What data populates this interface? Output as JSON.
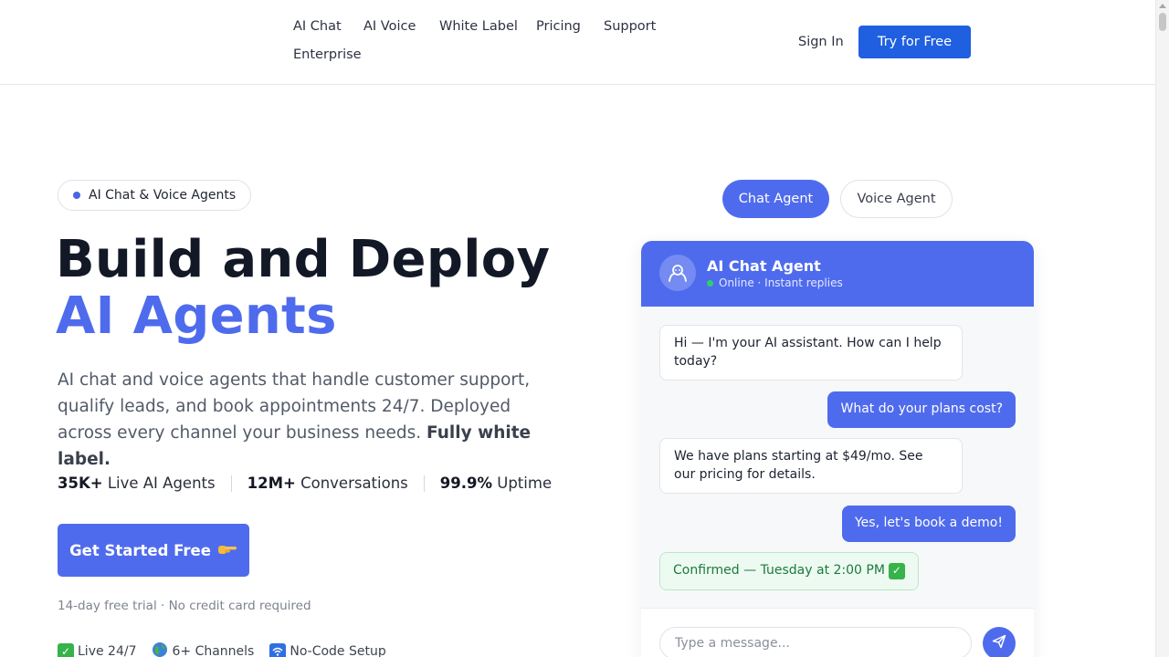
{
  "nav": {
    "links": [
      "AI Chat",
      "AI Voice",
      "White Label",
      "Pricing",
      "Support",
      "Enterprise"
    ],
    "sign_in": "Sign In",
    "try_free": "Try for Free",
    "accent_color": "#1f5fe0"
  },
  "hero": {
    "pill": "AI Chat & Voice Agents",
    "title_line1": "Build and Deploy",
    "title_line2": "AI Agents",
    "lede": "AI chat and voice agents that handle customer support, qualify leads, and book appointments 24/7. Deployed across every channel your business needs. ",
    "lede_strong": "Fully white label.",
    "stats": [
      {
        "value": "35K+",
        "label": " Live AI Agents"
      },
      {
        "value": "12M+",
        "label": " Conversations"
      },
      {
        "value": "99.9%",
        "label": " Uptime"
      }
    ],
    "cta": "Get Started Free",
    "cta_icon": "pointing-hand-icon",
    "trial_note": "14-day free trial · No credit card required",
    "badges": [
      {
        "icon": "check-icon",
        "label": "Live 24/7"
      },
      {
        "icon": "globe-icon",
        "label": "6+ Channels"
      },
      {
        "icon": "wifi-icon",
        "label": "No-Code Setup"
      }
    ],
    "brand_color": "#4f6bed"
  },
  "demo": {
    "tabs": [
      "Chat Agent",
      "Voice Agent"
    ],
    "active_tab": "Chat Agent",
    "agent_name": "AI Chat Agent",
    "agent_status": "Online · Instant replies",
    "messages": [
      {
        "from": "agent",
        "text": "Hi — I'm your AI assistant. How can I help today?"
      },
      {
        "from": "user",
        "text": "What do your plans cost?"
      },
      {
        "from": "agent",
        "text": "We have plans starting at $49/mo. See our pricing for details."
      },
      {
        "from": "user",
        "text": "Yes, let's book a demo!"
      },
      {
        "from": "confirm",
        "text": "Confirmed — Tuesday at 2:00 PM"
      }
    ],
    "input_placeholder": "Type a message..."
  }
}
